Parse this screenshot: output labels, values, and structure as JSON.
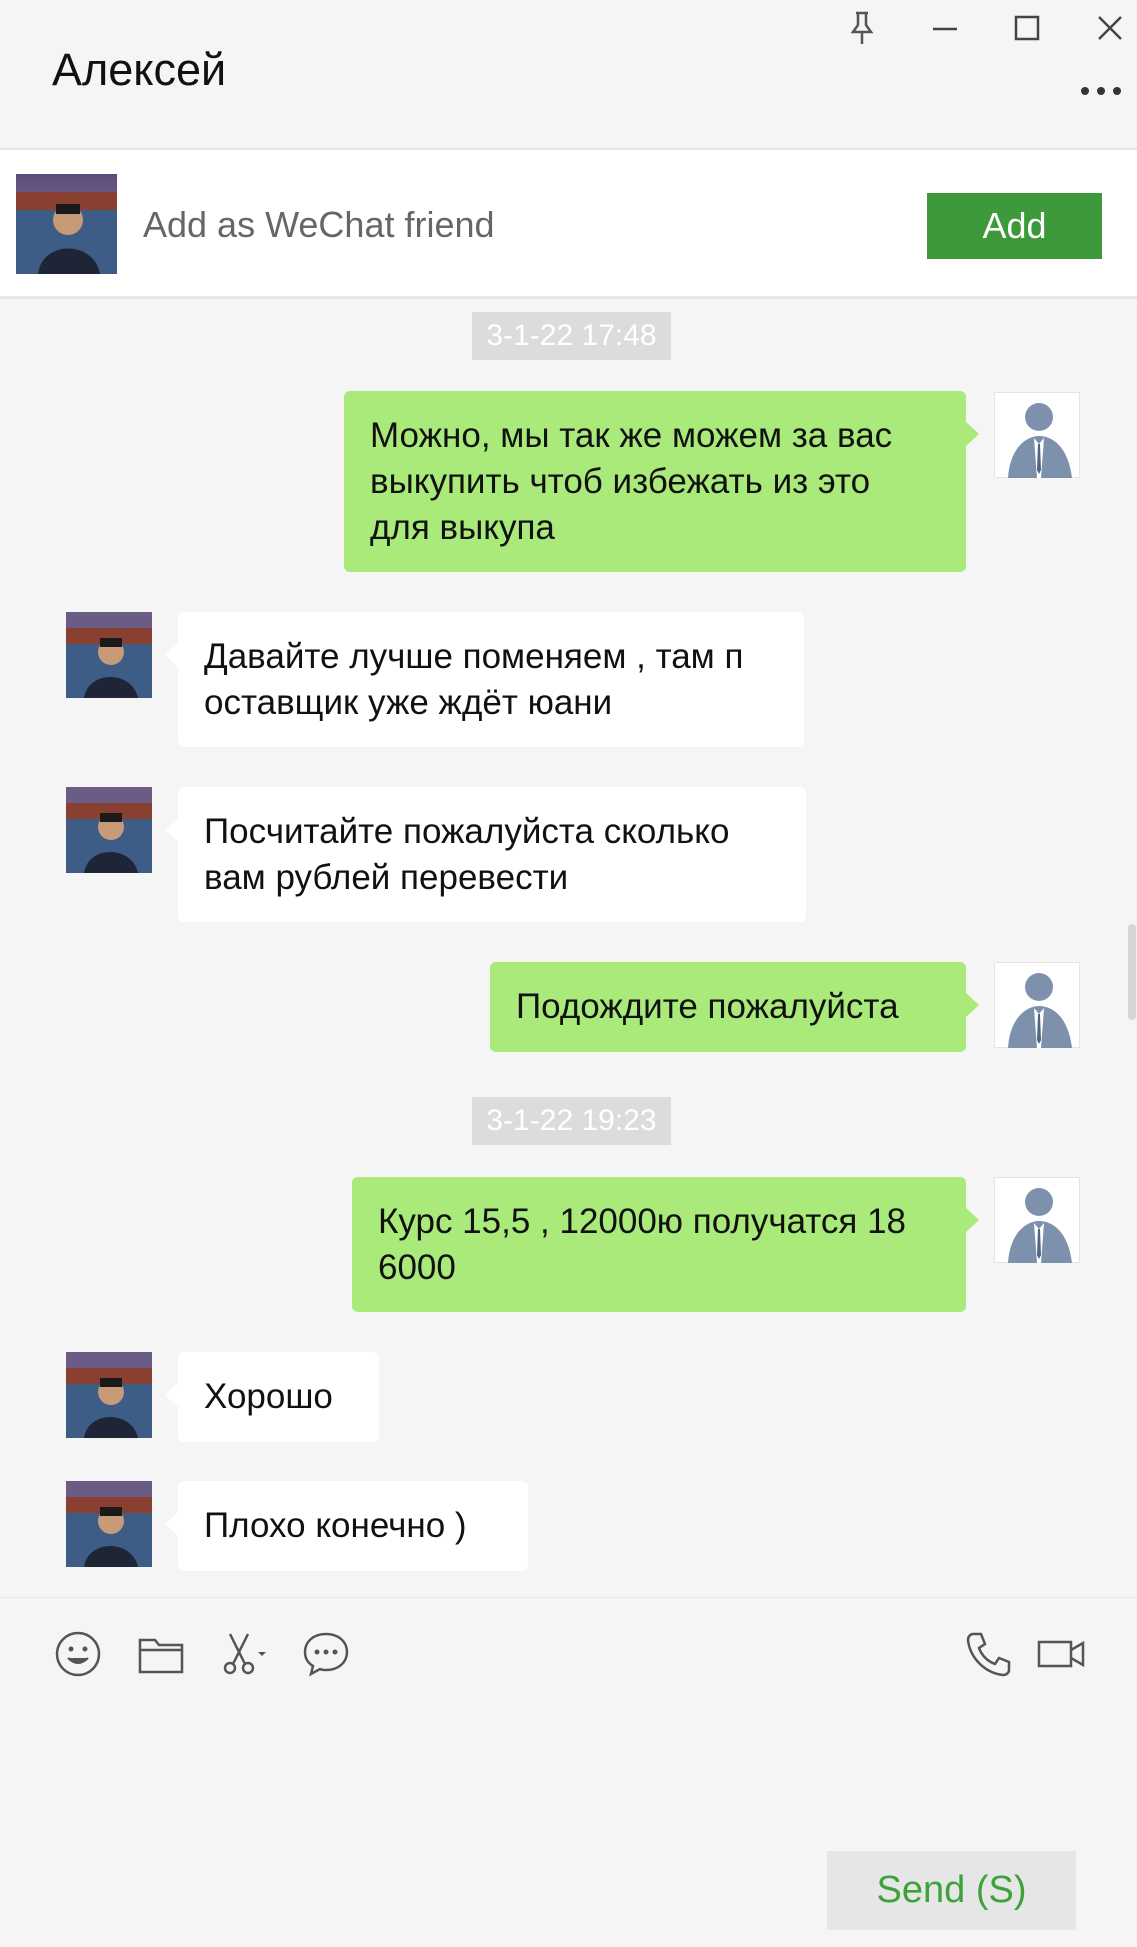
{
  "window": {
    "title": "Алексей",
    "controls": [
      "pin-icon",
      "minimize-icon",
      "maximize-icon",
      "close-icon",
      "more-icon"
    ]
  },
  "friend_bar": {
    "prompt": "Add as WeChat friend",
    "add_label": "Add"
  },
  "messages": {
    "ts1": "3-1-22 17:48",
    "m1": [
      "Можно, мы так же можем за вас",
      " выкупить чтоб избежать из это",
      "для выкупа"
    ],
    "m2": [
      "Давайте лучше поменяем , там п",
      "оставщик уже ждёт юани"
    ],
    "m3": [
      "Посчитайте пожалуйста сколько",
      "вам рублей перевести"
    ],
    "m4": [
      "Подождите пожалуйста"
    ],
    "ts2": "3-1-22 19:23",
    "m5": [
      "Курс 15,5 , 12000ю получатся 18",
      "6000"
    ],
    "m6": [
      "Хорошо"
    ],
    "m7": [
      "Плохо конечно )"
    ]
  },
  "toolbar": {
    "icons": [
      "emoji-icon",
      "folder-icon",
      "scissors-icon",
      "chat-history-icon",
      "phone-icon",
      "video-icon"
    ]
  },
  "send_label": "Send (S)",
  "colors": {
    "my_bubble": "#a9ea7a",
    "their_bubble": "#ffffff",
    "add_button": "#3d9a3a",
    "send_text": "#3da23a",
    "background": "#f5f5f5"
  }
}
